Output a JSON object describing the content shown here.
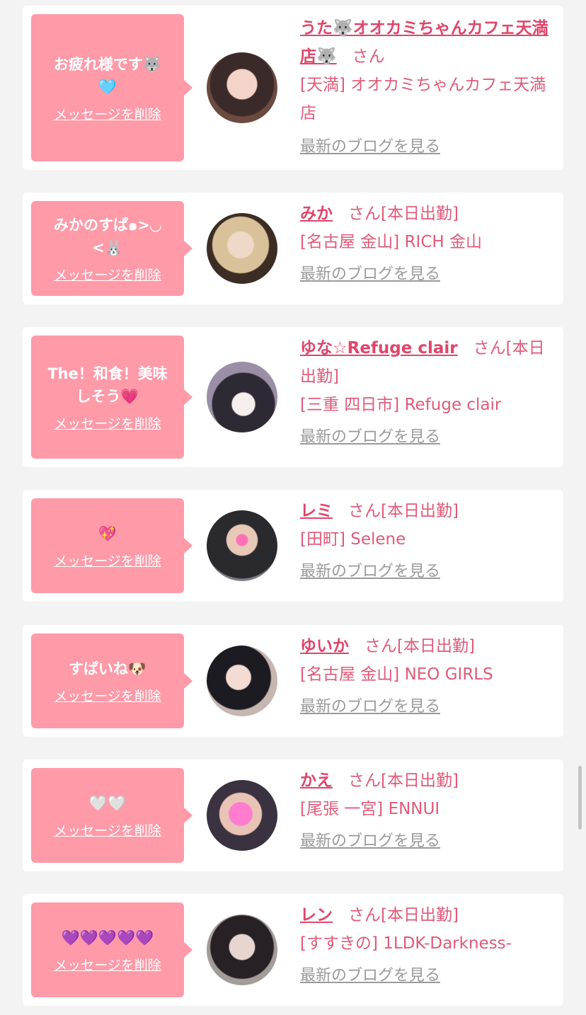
{
  "common": {
    "delete_label": "メッセージを削除",
    "blog_label": "最新のブログを見る",
    "san_label": "さん"
  },
  "colors": {
    "bubble_bg": "#ff9aa8",
    "name_link": "#e0456a",
    "text_pink": "#e05a78",
    "blog_gray": "#9a9a9a",
    "page_bg": "#f3f3f3"
  },
  "messages": [
    {
      "message": "お疲れ様です🐺\n🩵",
      "name": "うた🐺オオカミちゃんカフェ天満店🐺",
      "status": "",
      "shop": "[天満] オオカミちゃんカフェ天満店"
    },
    {
      "message": "みかのすぱ๑>◡\n<🐰",
      "name": "みか",
      "status": "[本日出勤]",
      "shop": "[名古屋 金山] RICH 金山"
    },
    {
      "message": "The！和食！美味\nしそう💗",
      "name": "ゆな☆Refuge clair",
      "status": "[本日出勤]",
      "shop": "[三重 四日市] Refuge clair"
    },
    {
      "message": "💖",
      "name": "レミ",
      "status": "[本日出勤]",
      "shop": "[田町] Selene"
    },
    {
      "message": "すぱいね🐶",
      "name": "ゆいか",
      "status": "[本日出勤]",
      "shop": "[名古屋 金山] NEO GIRLS"
    },
    {
      "message": "🤍🤍",
      "name": "かえ",
      "status": "[本日出勤]",
      "shop": "[尾張 一宮] ENNUI"
    },
    {
      "message": "💜💜💜💜💜",
      "name": "レン",
      "status": "[本日出勤]",
      "shop": "[すすきの] 1LDK-Darkness-"
    }
  ]
}
